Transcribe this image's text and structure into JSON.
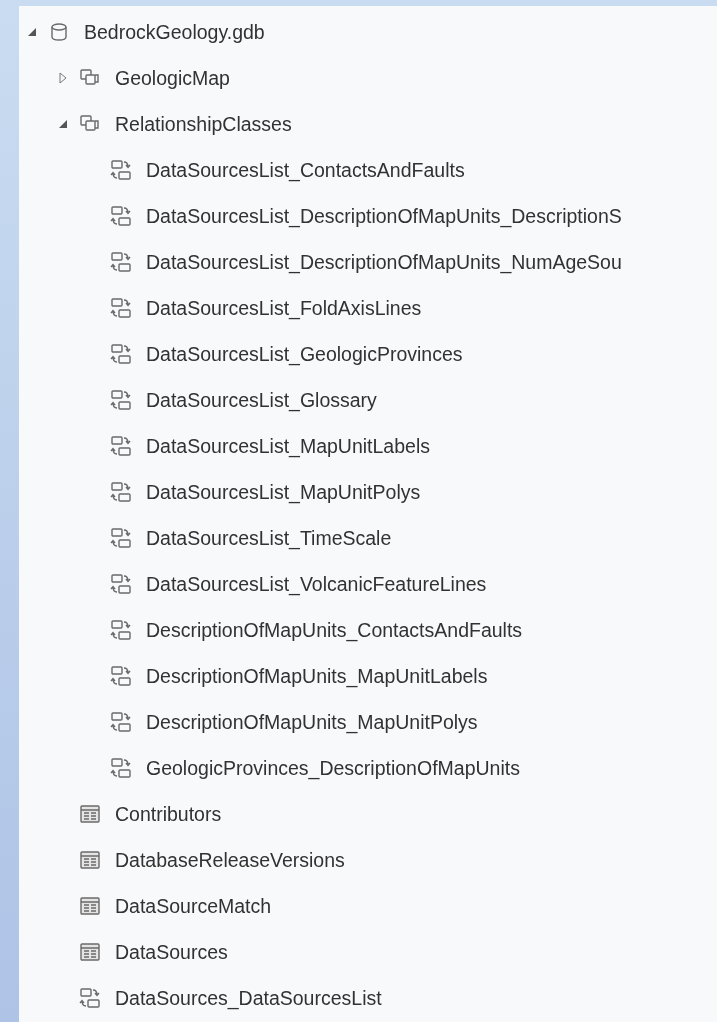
{
  "tree": [
    {
      "label": "BedrockGeology.gdb",
      "kind": "database",
      "expanded": true,
      "children": [
        {
          "label": "GeologicMap",
          "kind": "dataset",
          "expanded": false
        },
        {
          "label": "RelationshipClasses",
          "kind": "dataset",
          "expanded": true,
          "children": [
            {
              "label": "DataSourcesList_ContactsAndFaults",
              "kind": "relationship"
            },
            {
              "label": "DataSourcesList_DescriptionOfMapUnits_DescriptionS",
              "kind": "relationship"
            },
            {
              "label": "DataSourcesList_DescriptionOfMapUnits_NumAgeSou",
              "kind": "relationship"
            },
            {
              "label": "DataSourcesList_FoldAxisLines",
              "kind": "relationship"
            },
            {
              "label": "DataSourcesList_GeologicProvinces",
              "kind": "relationship"
            },
            {
              "label": "DataSourcesList_Glossary",
              "kind": "relationship"
            },
            {
              "label": "DataSourcesList_MapUnitLabels",
              "kind": "relationship"
            },
            {
              "label": "DataSourcesList_MapUnitPolys",
              "kind": "relationship"
            },
            {
              "label": "DataSourcesList_TimeScale",
              "kind": "relationship"
            },
            {
              "label": "DataSourcesList_VolcanicFeatureLines",
              "kind": "relationship"
            },
            {
              "label": "DescriptionOfMapUnits_ContactsAndFaults",
              "kind": "relationship"
            },
            {
              "label": "DescriptionOfMapUnits_MapUnitLabels",
              "kind": "relationship"
            },
            {
              "label": "DescriptionOfMapUnits_MapUnitPolys",
              "kind": "relationship"
            },
            {
              "label": "GeologicProvinces_DescriptionOfMapUnits",
              "kind": "relationship"
            }
          ]
        },
        {
          "label": "Contributors",
          "kind": "table"
        },
        {
          "label": "DatabaseReleaseVersions",
          "kind": "table"
        },
        {
          "label": "DataSourceMatch",
          "kind": "table"
        },
        {
          "label": "DataSources",
          "kind": "table"
        },
        {
          "label": "DataSources_DataSourcesList",
          "kind": "relationship"
        }
      ]
    }
  ]
}
